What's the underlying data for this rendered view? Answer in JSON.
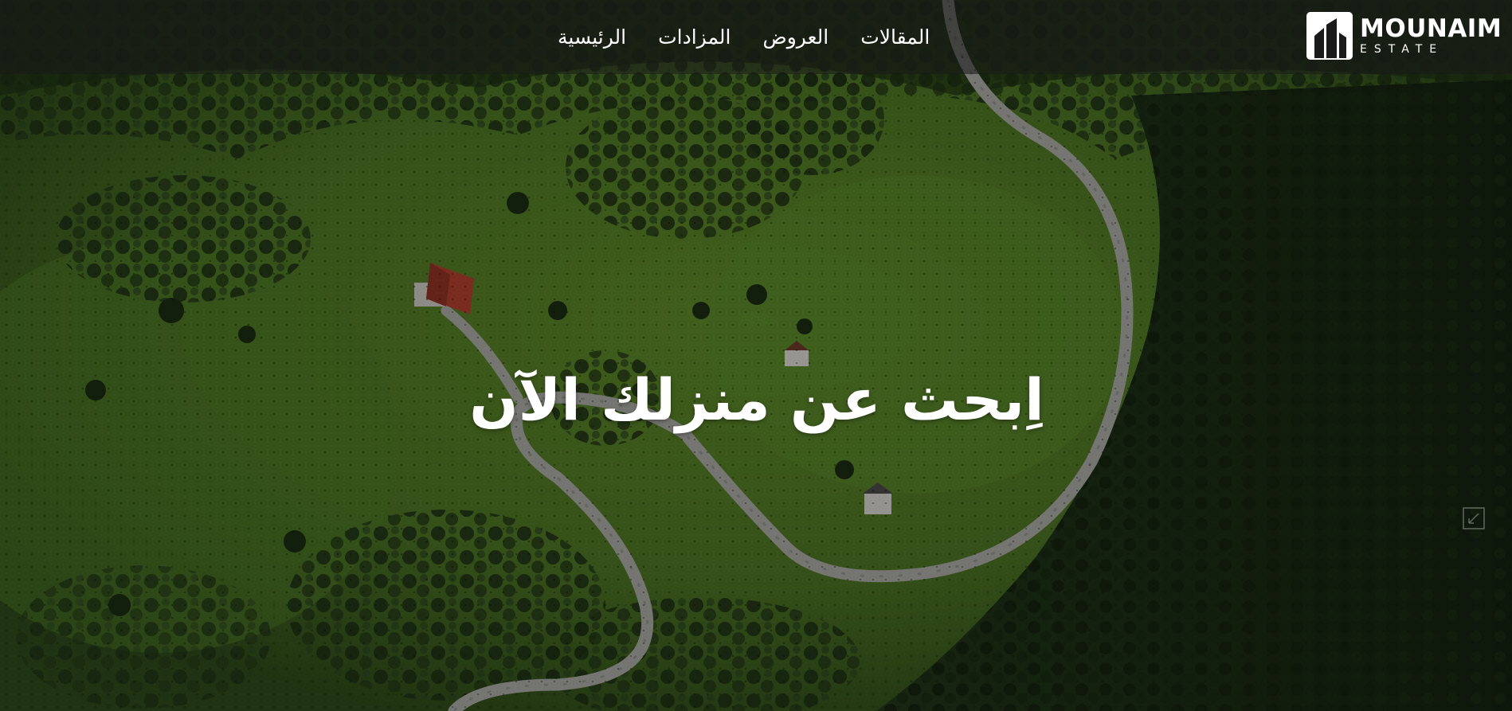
{
  "nav": {
    "items": [
      {
        "label": "الرئيسية"
      },
      {
        "label": "المزادات"
      },
      {
        "label": "العروض"
      },
      {
        "label": "المقالات"
      }
    ]
  },
  "logo": {
    "name": "MOUNAIM",
    "sub": "ESTATE",
    "icon": "building-logo-icon"
  },
  "hero": {
    "headline": "اِبحث عن منزلك الآن",
    "background": "aerial-landscape-photo"
  },
  "icons": {
    "expand": "expand-icon"
  },
  "colors": {
    "text": "#ffffff",
    "navbar": "#181818"
  }
}
